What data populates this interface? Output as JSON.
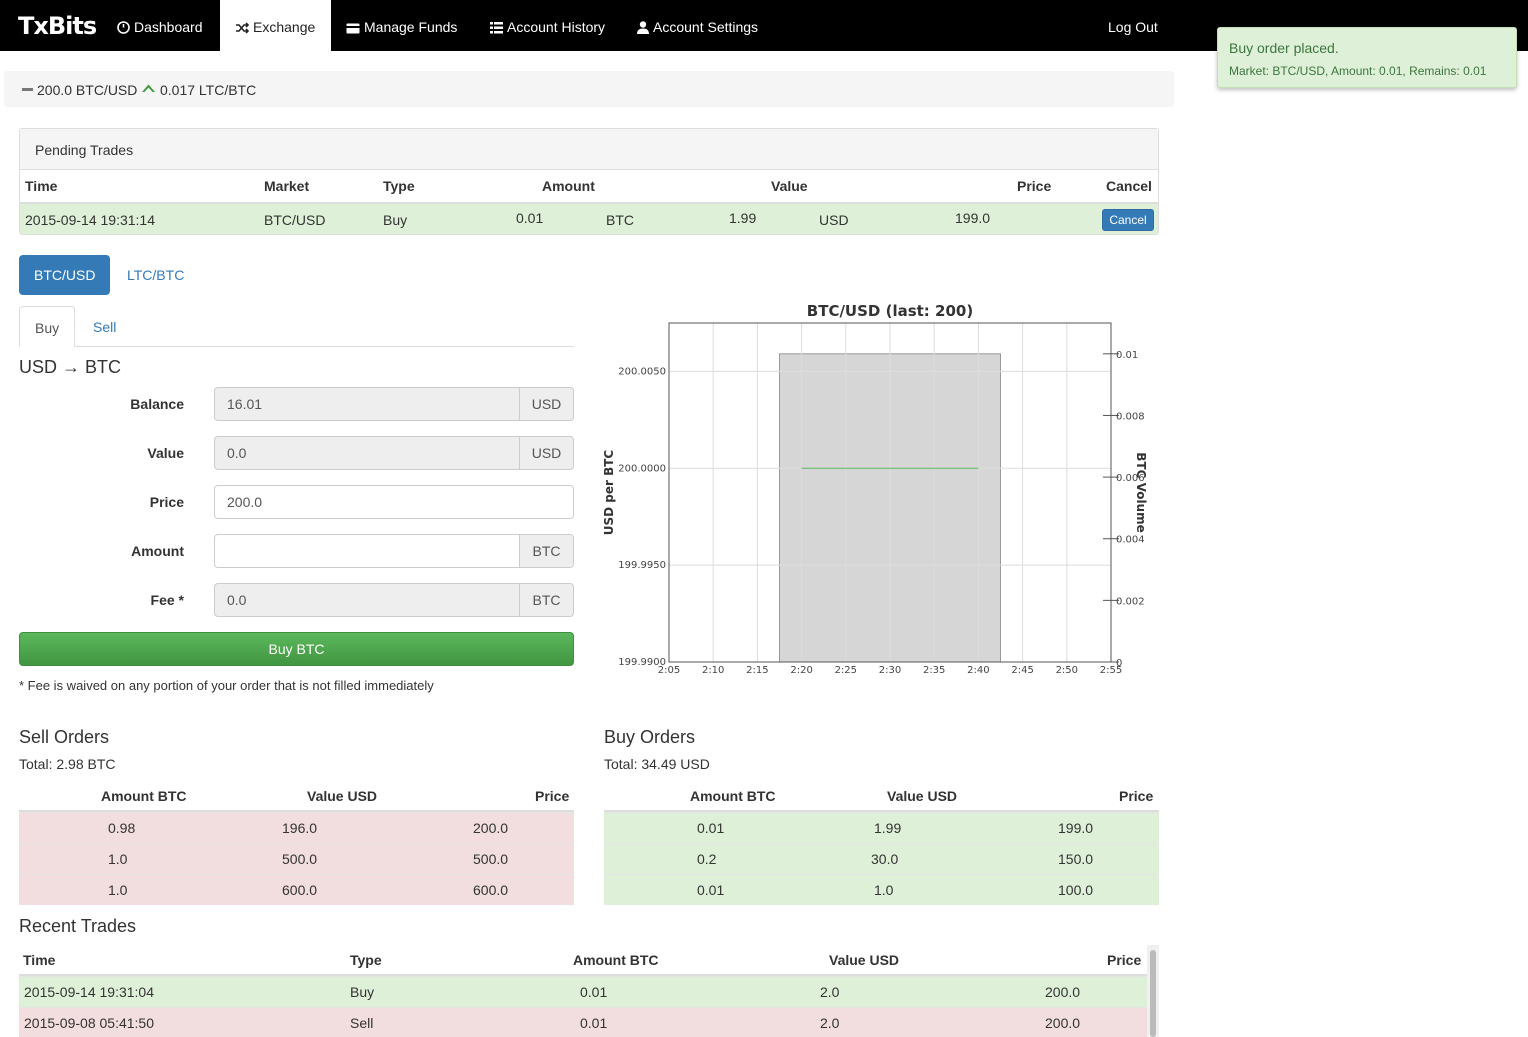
{
  "nav": {
    "brand": "TxBits",
    "items": [
      {
        "label": "Dashboard",
        "icon": "dashboard-icon"
      },
      {
        "label": "Exchange",
        "icon": "shuffle-icon",
        "active": true
      },
      {
        "label": "Manage Funds",
        "icon": "credit-card-icon"
      },
      {
        "label": "Account History",
        "icon": "list-icon"
      },
      {
        "label": "Account Settings",
        "icon": "user-icon"
      }
    ],
    "logout": "Log Out"
  },
  "toast": {
    "title": "Buy order placed.",
    "message": "Market: BTC/USD, Amount: 0.01, Remains: 0.01"
  },
  "ticker": {
    "btc_usd": "200.0 BTC/USD",
    "ltc_btc": "0.017 LTC/BTC",
    "colors": {
      "neutral": "#777777",
      "up": "#3c9a3c"
    }
  },
  "pending": {
    "title": "Pending Trades",
    "headers": {
      "time": "Time",
      "market": "Market",
      "type": "Type",
      "amount": "Amount",
      "value": "Value",
      "price": "Price",
      "cancel": "Cancel"
    },
    "rows": [
      {
        "time": "2015-09-14 19:31:14",
        "market": "BTC/USD",
        "type": "Buy",
        "amount": "0.01",
        "amount_unit": "BTC",
        "value": "1.99",
        "value_unit": "USD",
        "price": "199.0",
        "cancel_label": "Cancel"
      }
    ]
  },
  "markets": {
    "tabs": [
      "BTC/USD",
      "LTC/BTC"
    ],
    "active": "BTC/USD"
  },
  "order_tabs": [
    "Buy",
    "Sell"
  ],
  "form": {
    "heading": "USD → BTC",
    "balance": {
      "label": "Balance",
      "value": "16.01",
      "unit": "USD"
    },
    "value": {
      "label": "Value",
      "value": "0.0",
      "unit": "USD"
    },
    "price": {
      "label": "Price",
      "value": "200.0"
    },
    "amount": {
      "label": "Amount",
      "value": "",
      "unit": "BTC"
    },
    "fee": {
      "label": "Fee *",
      "value": "0.0",
      "unit": "BTC"
    },
    "submit": "Buy BTC",
    "note": "* Fee is waived on any portion of your order that is not filled immediately"
  },
  "chart_data": {
    "type": "line",
    "title": "BTC/USD (last: 200)",
    "ylabel": "USD per BTC",
    "y2label": "BTC Volume",
    "x_ticks": [
      "2:05",
      "2:10",
      "2:15",
      "2:20",
      "2:25",
      "2:30",
      "2:35",
      "2:40",
      "2:45",
      "2:50",
      "2:55"
    ],
    "y_ticks": [
      "199.9900",
      "199.9950",
      "200.0000",
      "200.0050"
    ],
    "y2_ticks": [
      "0",
      "0.002",
      "0.004",
      "0.006",
      "0.008",
      "0.01"
    ],
    "ylim": [
      199.99,
      200.0075
    ],
    "y2lim": [
      0,
      0.011
    ],
    "grid": true,
    "series": [
      {
        "name": "Price",
        "x": [
          "2:20",
          "2:40"
        ],
        "values": [
          200.0,
          200.0
        ],
        "color": "#5cb85c"
      }
    ],
    "volume_bars": [
      {
        "x_start": "2:17:30",
        "x_end": "2:42:30",
        "value": 0.01
      }
    ]
  },
  "sell_orders": {
    "title": "Sell Orders",
    "total": "Total: 2.98 BTC",
    "headers": [
      "Amount BTC",
      "Value USD",
      "Price"
    ],
    "rows": [
      [
        "0.98",
        "196.0",
        "200.0"
      ],
      [
        "1.0",
        "500.0",
        "500.0"
      ],
      [
        "1.0",
        "600.0",
        "600.0"
      ]
    ]
  },
  "buy_orders": {
    "title": "Buy Orders",
    "total": "Total: 34.49 USD",
    "headers": [
      "Amount BTC",
      "Value USD",
      "Price"
    ],
    "rows": [
      [
        "0.01",
        "1.99",
        "199.0"
      ],
      [
        "0.2",
        "30.0",
        "150.0"
      ],
      [
        "0.01",
        "1.0",
        "100.0"
      ]
    ]
  },
  "recent_trades": {
    "title": "Recent Trades",
    "headers": [
      "Time",
      "Type",
      "Amount BTC",
      "Value USD",
      "Price"
    ],
    "rows": [
      {
        "time": "2015-09-14 19:31:04",
        "type": "Buy",
        "amount": "0.01",
        "value": "2.0",
        "price": "200.0"
      },
      {
        "time": "2015-09-08 05:41:50",
        "type": "Sell",
        "amount": "0.01",
        "value": "2.0",
        "price": "200.0"
      }
    ]
  }
}
